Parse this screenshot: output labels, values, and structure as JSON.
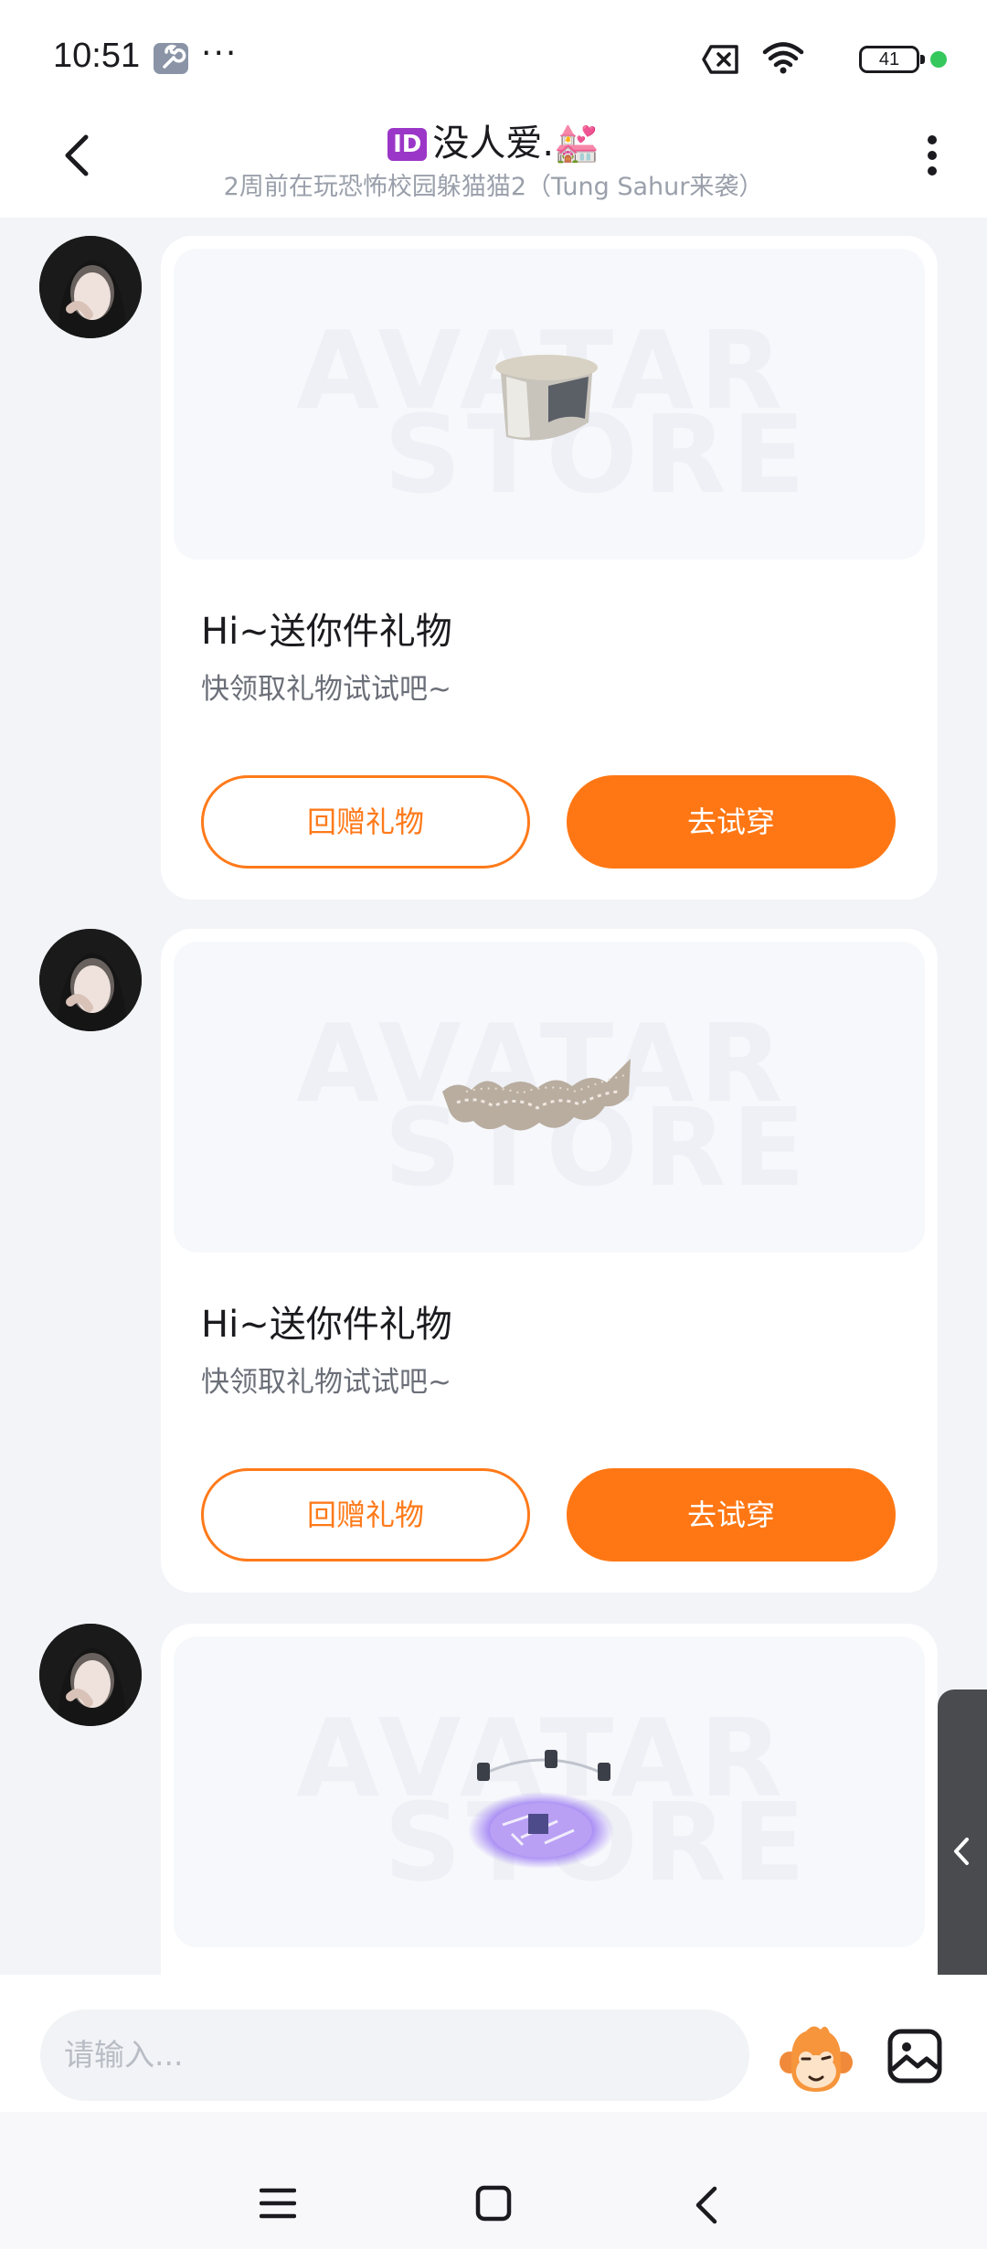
{
  "status_bar": {
    "time": "10:51",
    "dots": "···",
    "battery": "41",
    "icons": [
      "wrench-icon",
      "x-box-icon",
      "wifi-icon",
      "battery-icon",
      "green-dot"
    ]
  },
  "header": {
    "id_badge": "ID",
    "title": "没人爱.💒",
    "subtitle": "2周前在玩恐怖校园躲猫猫2（Tung Sahur来袭）"
  },
  "cards": [
    {
      "watermark_top": "AVATAR",
      "watermark_bottom": "STORE",
      "title": "Hi~送你件礼物",
      "subtitle": "快领取礼物试试吧~",
      "return_label": "回赠礼物",
      "try_label": "去试穿",
      "item_icon": "hat-icon"
    },
    {
      "watermark_top": "AVATAR",
      "watermark_bottom": "STORE",
      "title": "Hi~送你件礼物",
      "subtitle": "快领取礼物试试吧~",
      "return_label": "回赠礼物",
      "try_label": "去试穿",
      "item_icon": "lace-collar-icon"
    },
    {
      "watermark_top": "AVATAR",
      "watermark_bottom": "STORE",
      "item_icon": "glowing-platform-icon"
    }
  ],
  "input": {
    "placeholder": "请输入..."
  },
  "colors": {
    "accent": "#ff7714",
    "background": "#f3f4f8",
    "card": "#ffffff"
  }
}
